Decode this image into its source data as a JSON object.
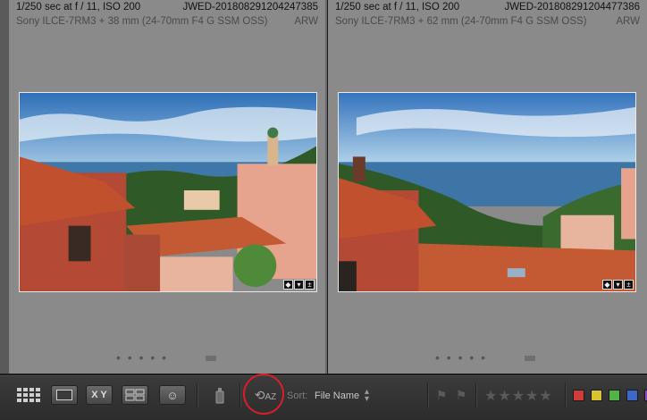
{
  "cells": [
    {
      "exposure": "1/250 sec at f / 11, ISO 200",
      "filename": "JWED-20180829120424738​5",
      "camera": "Sony ILCE-7RM3 + 38 mm (24-70mm F4 G SSM OSS)",
      "format": "ARW"
    },
    {
      "exposure": "1/250 sec at f / 11, ISO 200",
      "filename": "JWED-20180829120447738​6",
      "camera": "Sony ILCE-7RM3 + 62 mm (24-70mm F4 G SSM OSS)",
      "format": "ARW"
    }
  ],
  "cell_dots": "• • • • •",
  "toolbar": {
    "compare_xy": "X Y",
    "sort_label": "Sort:",
    "sort_value": "File Name",
    "sort_direction_icon": "AZ",
    "stars": "★★★★★",
    "color_labels": [
      "#d23b3b",
      "#d8c330",
      "#52b347",
      "#3d68c8",
      "#8a4bc2"
    ]
  }
}
